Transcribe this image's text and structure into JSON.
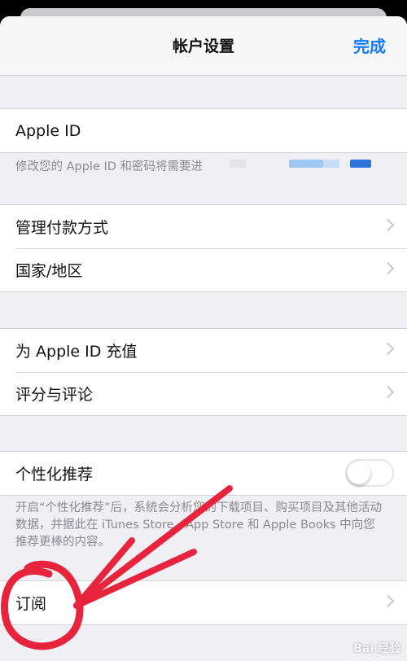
{
  "nav": {
    "title": "帐户设置",
    "done_label": "完成"
  },
  "apple_id": {
    "label": "Apple ID",
    "note": "修改您的 Apple ID 和密码将需要进"
  },
  "payment_group": {
    "items": [
      {
        "label": "管理付款方式"
      },
      {
        "label": "国家/地区"
      }
    ]
  },
  "credit_group": {
    "items": [
      {
        "label": "为 Apple ID 充值"
      },
      {
        "label": "评分与评论"
      }
    ]
  },
  "personalization": {
    "label": "个性化推荐",
    "enabled": false,
    "note": "开启“个性化推荐”后，系统会分析您的下载项目、购买项目及其他活动数据，并据此在 iTunes Store、App Store 和 Apple Books 中向您推荐更棒的内容。"
  },
  "subscription": {
    "label": "订阅"
  },
  "watermark": {
    "text": "Bai 经验"
  },
  "colors": {
    "accent": "#1479f6",
    "annotation": "#e8243c",
    "background": "#efeff4"
  }
}
